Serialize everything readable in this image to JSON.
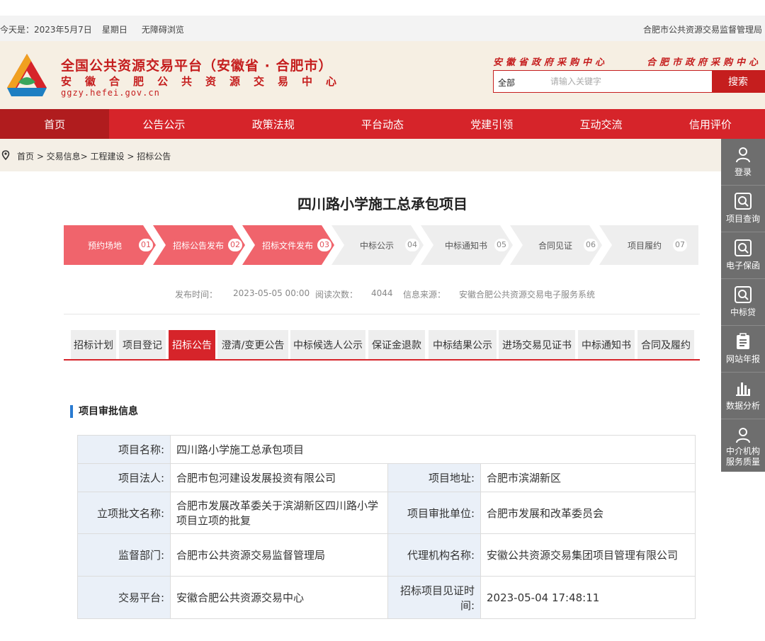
{
  "topbar": {
    "date": "今天是：2023年5月7日",
    "weekday": "星期日",
    "accessibility": "无障碍浏览",
    "org": "合肥市公共资源交易监督管理局"
  },
  "header": {
    "title": "全国公共资源交易平台（安徽省 · 合肥市）",
    "subtitle": "安徽合肥公共资源交易中心",
    "url": "ggzy.hefei.gov.cn",
    "link1": "安徽省政府采购中心",
    "link2": "合肥市政府采购中心"
  },
  "search": {
    "category": "全部",
    "placeholder": "请输入关键字",
    "button": "搜索"
  },
  "nav": [
    {
      "label": "首页"
    },
    {
      "label": "公告公示"
    },
    {
      "label": "政策法规"
    },
    {
      "label": "平台动态"
    },
    {
      "label": "党建引领"
    },
    {
      "label": "互动交流"
    },
    {
      "label": "信用评价"
    }
  ],
  "breadcrumb": "首页 > 交易信息> 工程建设 > 招标公告",
  "sidebar": [
    {
      "label": "登录",
      "icon": "user-icon"
    },
    {
      "label": "项目查询",
      "icon": "search-icon"
    },
    {
      "label": "电子保函",
      "icon": "search-icon"
    },
    {
      "label": "中标贷",
      "icon": "search-icon"
    },
    {
      "label": "网站年报",
      "icon": "clipboard-icon"
    },
    {
      "label": "数据分析",
      "icon": "bar-chart-icon"
    },
    {
      "label": "中介机构服务质量",
      "icon": "user-icon"
    }
  ],
  "page_title": "四川路小学施工总承包项目",
  "steps": [
    {
      "label": "预约场地",
      "num": "01",
      "done": true
    },
    {
      "label": "招标公告发布",
      "num": "02",
      "done": true
    },
    {
      "label": "招标文件发布",
      "num": "03",
      "done": true
    },
    {
      "label": "中标公示",
      "num": "04",
      "done": false
    },
    {
      "label": "中标通知书",
      "num": "05",
      "done": false
    },
    {
      "label": "合同见证",
      "num": "06",
      "done": false
    },
    {
      "label": "项目履约",
      "num": "07",
      "done": false
    }
  ],
  "meta": {
    "publish_label": "发布时间：",
    "publish_time": "2023-05-05 00:00",
    "views_label": "阅读次数：",
    "views": "4044",
    "source_label": "信息来源：",
    "source": "安徽合肥公共资源交易电子服务系统"
  },
  "tabs": [
    {
      "label": "招标计划"
    },
    {
      "label": "项目登记"
    },
    {
      "label": "招标公告",
      "active": true
    },
    {
      "label": "澄清/变更公告"
    },
    {
      "label": "中标候选人公示"
    },
    {
      "label": "保证金退款"
    },
    {
      "label": "中标结果公示"
    },
    {
      "label": "进场交易见证书"
    },
    {
      "label": "中标通知书"
    },
    {
      "label": "合同及履约"
    }
  ],
  "section_title": "项目审批信息",
  "info": {
    "name_label": "项目名称:",
    "name": "四川路小学施工总承包项目",
    "legal_label": "项目法人:",
    "legal": "合肥市包河建设发展投资有限公司",
    "address_label": "项目地址:",
    "address": "合肥市滨湖新区",
    "approval_doc_label": "立项批文名称:",
    "approval_doc": "合肥市发展改革委关于滨湖新区四川路小学项目立项的批复",
    "approval_unit_label": "项目审批单位:",
    "approval_unit": "合肥市发展和改革委员会",
    "supervisor_label": "监督部门:",
    "supervisor": "合肥市公共资源交易监督管理局",
    "agency_label": "代理机构名称:",
    "agency": "安徽公共资源交易集团项目管理有限公司",
    "platform_label": "交易平台:",
    "platform": "安徽合肥公共资源交易中心",
    "witness_label": "招标项目见证时间:",
    "witness_time": "2023-05-04 17:48:11"
  }
}
